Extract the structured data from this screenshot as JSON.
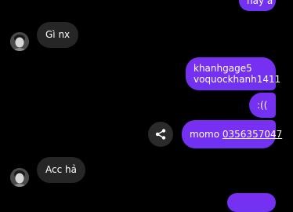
{
  "thread": {
    "messages": [
      {
        "sender": "me",
        "text": "hay á"
      },
      {
        "sender": "them",
        "text": "Gì nx"
      },
      {
        "sender": "me",
        "lines": [
          "khanhgage5",
          "voquockhanh1411"
        ]
      },
      {
        "sender": "me",
        "text": ":(("
      },
      {
        "sender": "me",
        "prefix": "momo ",
        "link": "0356357047"
      },
      {
        "sender": "them",
        "text": "Acc hả"
      },
      {
        "sender": "me",
        "text": ""
      }
    ]
  },
  "icons": {
    "avatar": "avatar-icon",
    "share": "share-icon"
  },
  "colors": {
    "background": "#000000",
    "incoming_bubble": "#262626",
    "outgoing_bubble": "#7a2ff0",
    "text": "#ffffff"
  }
}
